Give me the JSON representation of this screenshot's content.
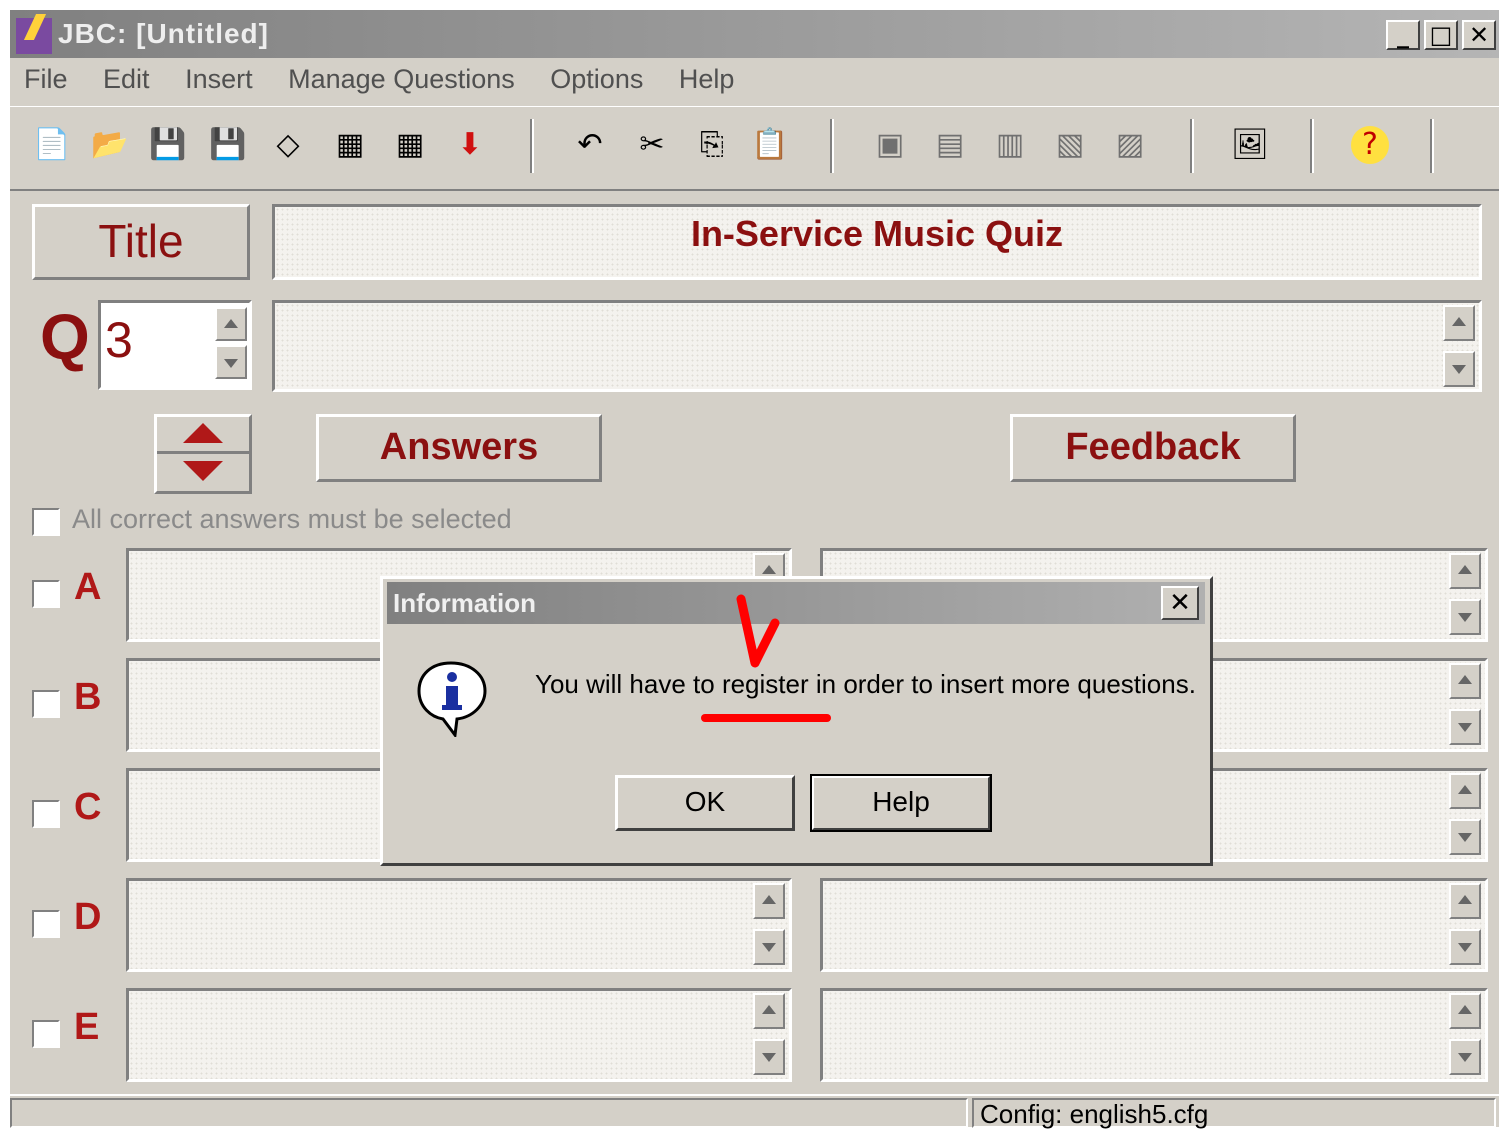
{
  "window": {
    "title": "JBC: [Untitled]"
  },
  "menu": [
    "File",
    "Edit",
    "Insert",
    "Manage Questions",
    "Options",
    "Help"
  ],
  "form": {
    "title_button": "Title",
    "title_value": "In-Service Music Quiz",
    "q_label": "Q",
    "q_number": "3",
    "answers_button": "Answers",
    "feedback_button": "Feedback",
    "all_correct_label": "All correct answers must be selected",
    "rows": [
      "A",
      "B",
      "C",
      "D",
      "E"
    ]
  },
  "dialog": {
    "title": "Information",
    "message": "You will have to register in order to insert more questions.",
    "ok": "OK",
    "help": "Help"
  },
  "status": {
    "config": "Config: english5.cfg"
  },
  "colors": {
    "label_red": "#8b1010",
    "annotation_red": "#ff0000"
  }
}
